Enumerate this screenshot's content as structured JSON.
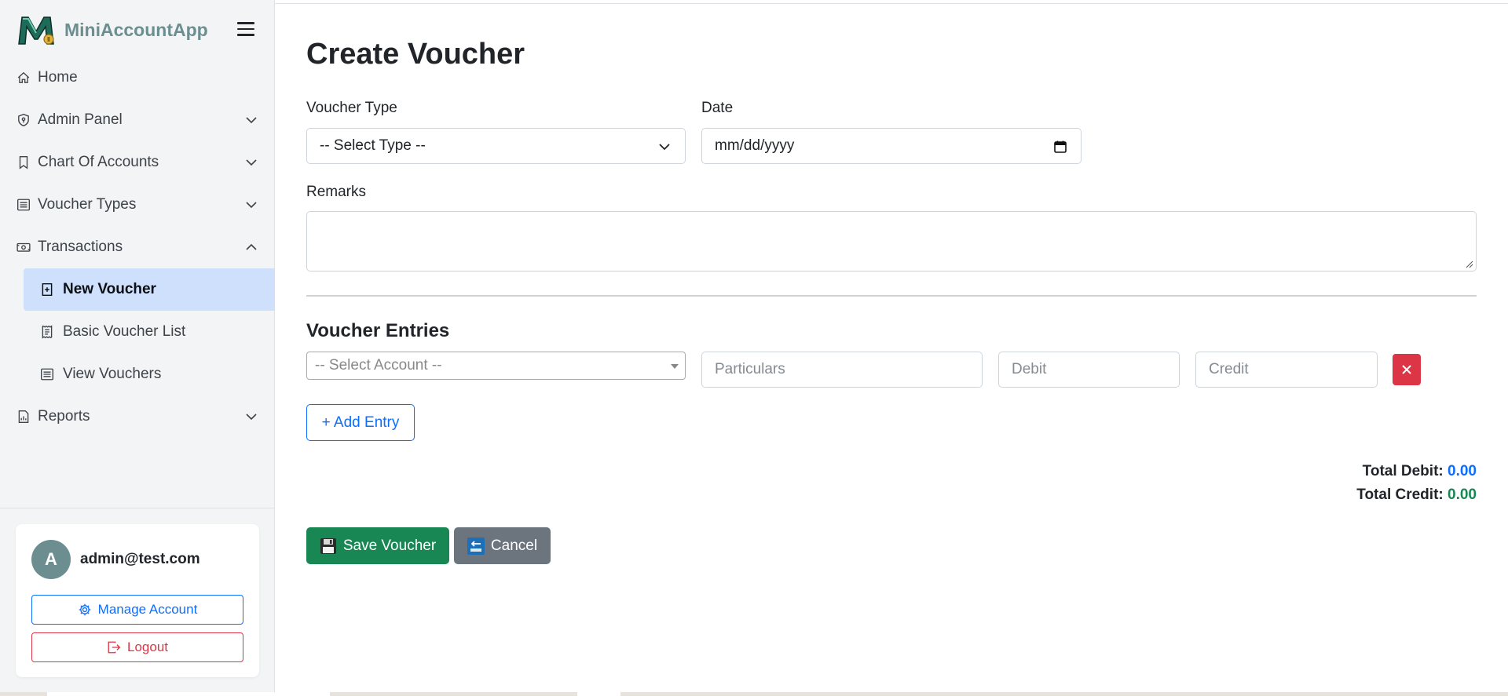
{
  "brand": {
    "name": "MiniAccountApp"
  },
  "sidebar": {
    "items": [
      {
        "label": "Home",
        "icon": "home-icon"
      },
      {
        "label": "Admin Panel",
        "icon": "shield-icon",
        "expanded": false
      },
      {
        "label": "Chart Of Accounts",
        "icon": "bookmark-icon",
        "expanded": false
      },
      {
        "label": "Voucher Types",
        "icon": "list-icon",
        "expanded": false
      },
      {
        "label": "Transactions",
        "icon": "cash-icon",
        "expanded": true
      },
      {
        "label": "Reports",
        "icon": "report-icon",
        "expanded": false
      }
    ],
    "subitems": [
      {
        "label": "New Voucher",
        "icon": "file-plus-icon",
        "active": true
      },
      {
        "label": "Basic Voucher List",
        "icon": "receipt-icon",
        "active": false
      },
      {
        "label": "View Vouchers",
        "icon": "list-icon",
        "active": false
      }
    ]
  },
  "user": {
    "avatar_letter": "A",
    "email": "admin@test.com",
    "manage_label": "Manage Account",
    "logout_label": "Logout"
  },
  "form": {
    "title": "Create Voucher",
    "voucher_type_label": "Voucher Type",
    "voucher_type_value": "-- Select Type --",
    "date_label": "Date",
    "date_placeholder": "mm/dd/yyyy",
    "remarks_label": "Remarks",
    "remarks_value": ""
  },
  "entries": {
    "title": "Voucher Entries",
    "account_placeholder": "-- Select Account --",
    "particulars_placeholder": "Particulars",
    "debit_placeholder": "Debit",
    "credit_placeholder": "Credit",
    "add_label": "+ Add Entry"
  },
  "totals": {
    "debit_label": "Total Debit:",
    "debit_value": "0.00",
    "credit_label": "Total Credit:",
    "credit_value": "0.00"
  },
  "actions": {
    "save_label": "Save Voucher",
    "cancel_label": "Cancel"
  },
  "colors": {
    "brand": "#6c8e91",
    "primary": "#0d6efd",
    "success": "#198754",
    "danger": "#dc3545",
    "secondary": "#6c757d",
    "active_bg": "#cfe0fc"
  }
}
